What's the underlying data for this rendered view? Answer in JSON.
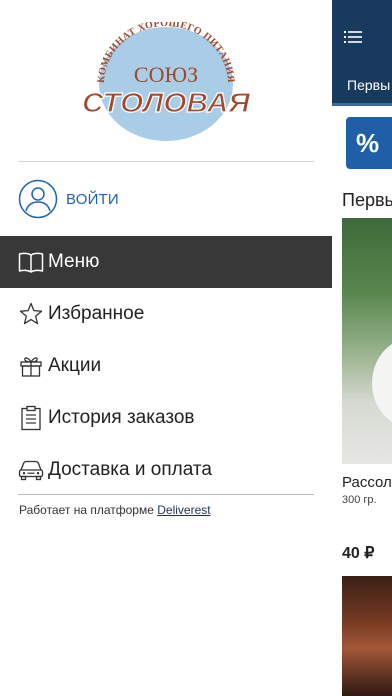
{
  "drawer": {
    "logo": {
      "arc_text": "КОМБИНАТ ХОРОШЕГО ПИТАНИЯ",
      "word_top": "СОЮЗ",
      "word_main": "СТОЛОВАЯ"
    },
    "login_label": "ВОЙТИ",
    "menu": [
      {
        "label": "Меню",
        "icon": "book-icon",
        "active": true
      },
      {
        "label": "Избранное",
        "icon": "star-icon",
        "active": false
      },
      {
        "label": "Акции",
        "icon": "gift-icon",
        "active": false
      },
      {
        "label": "История заказов",
        "icon": "clipboard-icon",
        "active": false
      },
      {
        "label": "Доставка и оплата",
        "icon": "car-icon",
        "active": false
      }
    ],
    "footer": {
      "text": "Работает на платформе",
      "link": "Deliverest"
    }
  },
  "app": {
    "tab_label": "Первы",
    "promo_symbol": "%",
    "section_title": "Первы",
    "dish": {
      "name": "Рассол",
      "weight": "300 гр.",
      "price": "40 ₽"
    }
  },
  "colors": {
    "accent": "#1e64b4",
    "active_bg": "#383838",
    "header_bg": "#173a5e",
    "logo_circle": "#a9cde6",
    "logo_brown": "#a0492e"
  }
}
